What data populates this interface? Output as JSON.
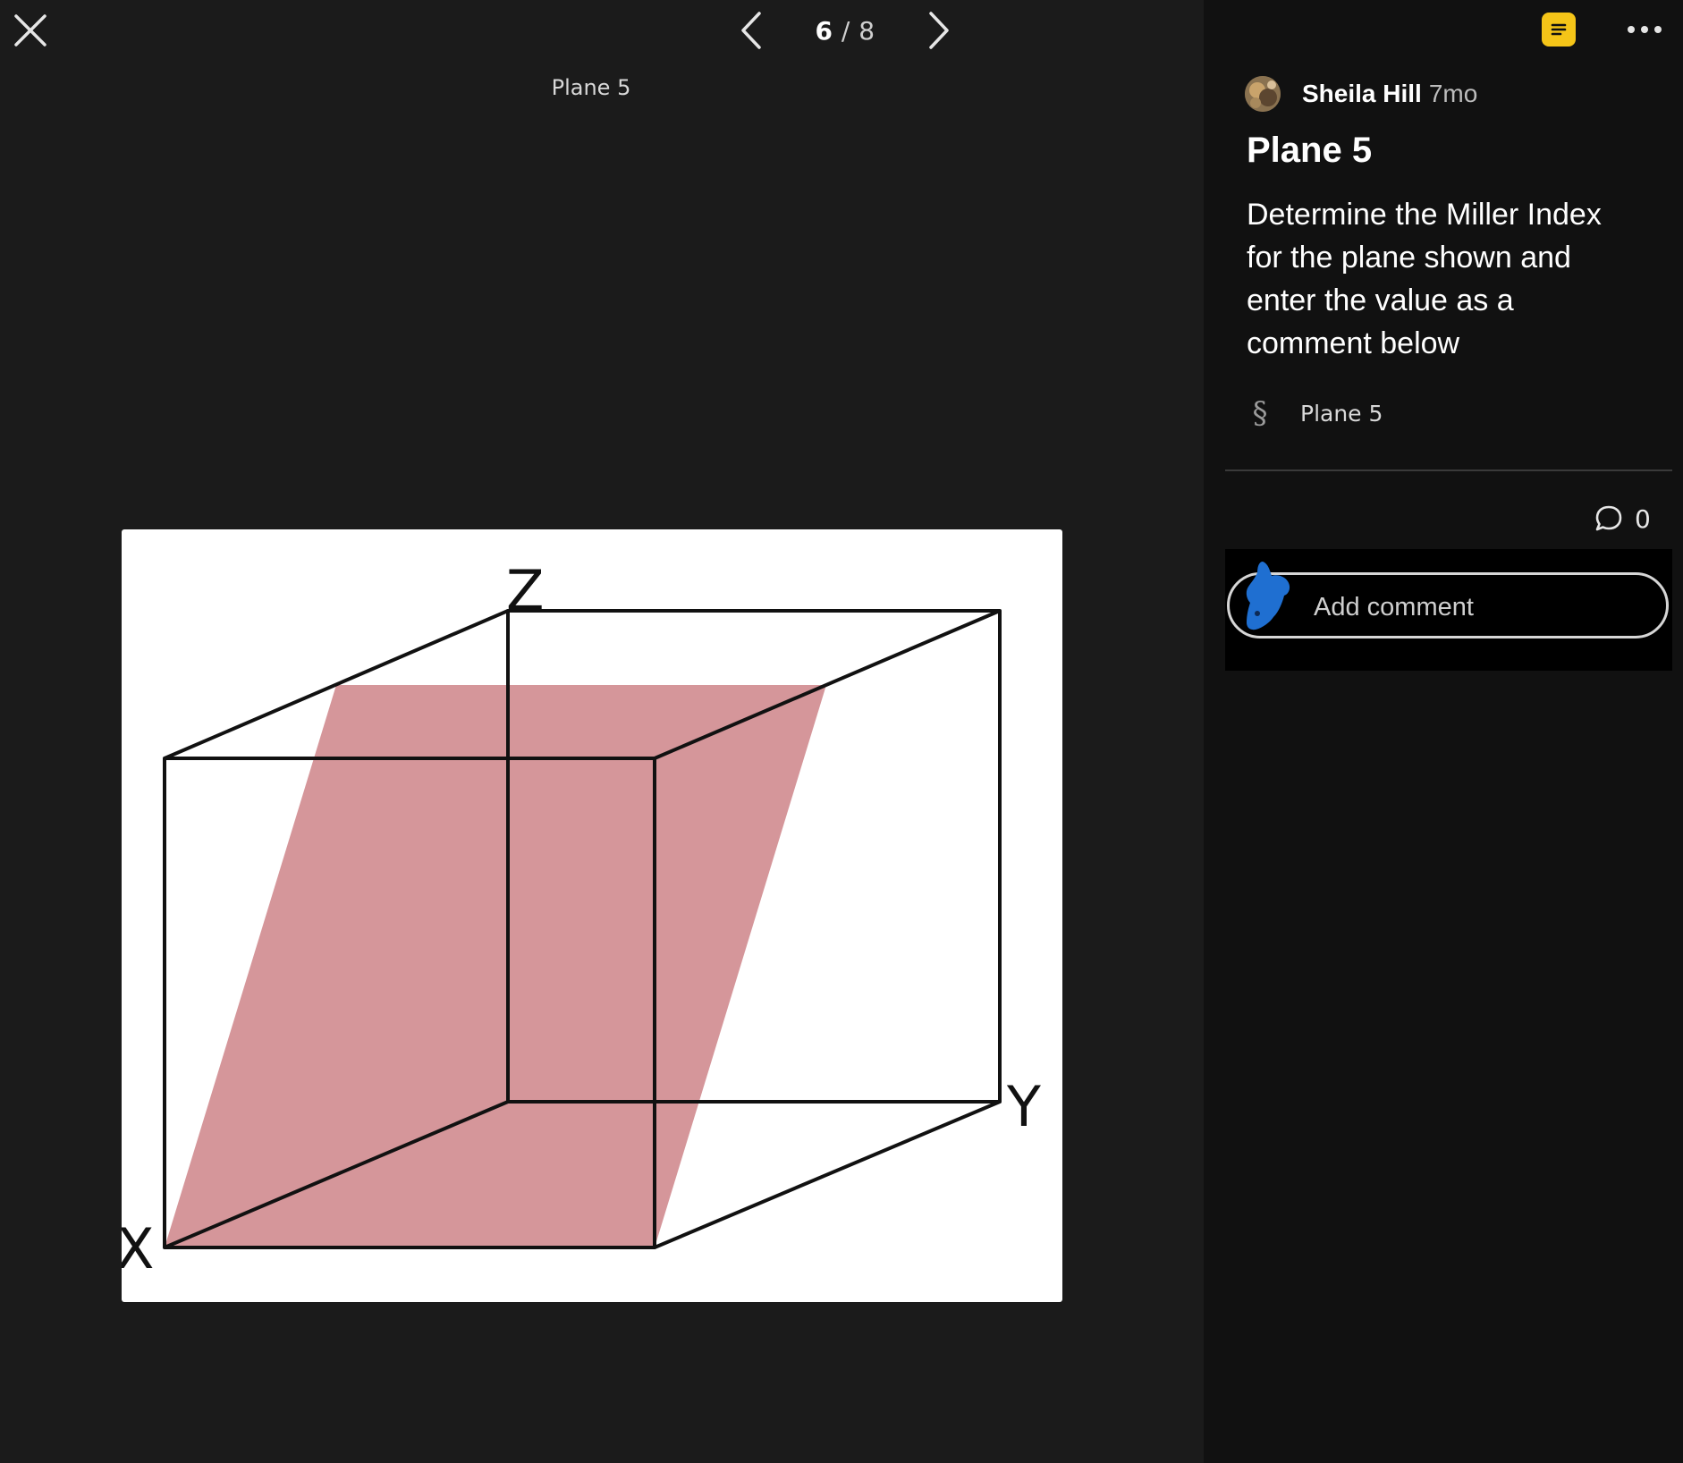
{
  "viewer": {
    "pager": {
      "current": "6",
      "separator": "/",
      "total": "8"
    },
    "caption": "Plane 5",
    "figure": {
      "axis_labels": {
        "z": "Z",
        "y": "Y",
        "x": "X"
      },
      "plane_color": "#d5969a"
    }
  },
  "post": {
    "author": "Sheila Hill",
    "time": "7mo",
    "title": "Plane 5",
    "body": "Determine the Miller Index for the plane shown and enter the value as a comment below",
    "section_icon": "§",
    "section_label": "Plane 5"
  },
  "comments": {
    "count": "0",
    "placeholder": "Add comment"
  },
  "colors": {
    "background": "#1b1b1b",
    "panel": "#111111",
    "accent_yellow": "#f5c518",
    "avatar_blue": "#1f6fd1"
  },
  "icons": {
    "close": "close-icon",
    "prev": "chevron-left-icon",
    "next": "chevron-right-icon",
    "notes": "notes-icon",
    "more": "more-icon",
    "comment": "comment-bubble-icon"
  }
}
